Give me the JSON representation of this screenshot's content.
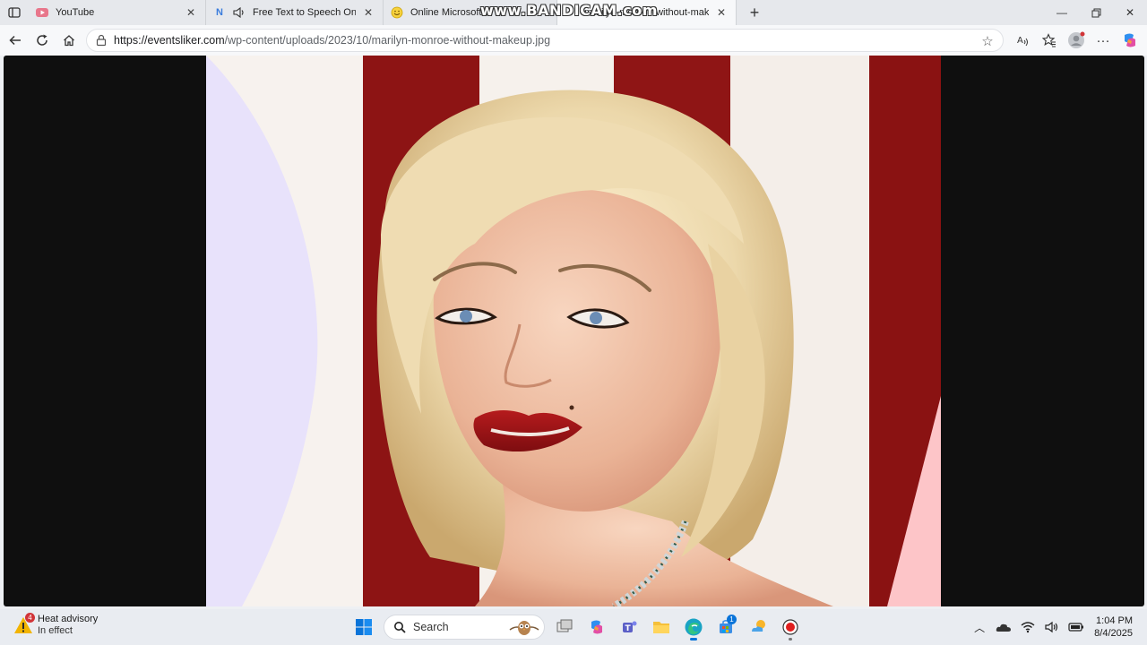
{
  "tabs": [
    {
      "title": "YouTube",
      "favicon": "youtube-icon",
      "active": false
    },
    {
      "title": "Free Text to Speech Online w",
      "favicon": "n-logo-icon",
      "active": false
    },
    {
      "title": "Online Microsoft S",
      "favicon": "smiley-icon",
      "active": false
    },
    {
      "title": "marilyn-monroe-without-makeup",
      "favicon": "image-icon",
      "active": true
    }
  ],
  "watermark": "www.BANDICAM.com",
  "address": {
    "host": "https://eventsliker.com",
    "path": "/wp-content/uploads/2023/10/marilyn-monroe-without-makeup.jpg"
  },
  "weather": {
    "title": "Heat advisory",
    "subtitle": "In effect",
    "badge": "4"
  },
  "taskbar": {
    "search_label": "Search",
    "store_badge": "1"
  },
  "clock": {
    "time": "1:04 PM",
    "date": "8/4/2025"
  },
  "colors": {
    "stripe_red": "#8f1414",
    "hair": "#f0dfb8",
    "skin": "#f2c4a7",
    "lips": "#9e1416"
  }
}
